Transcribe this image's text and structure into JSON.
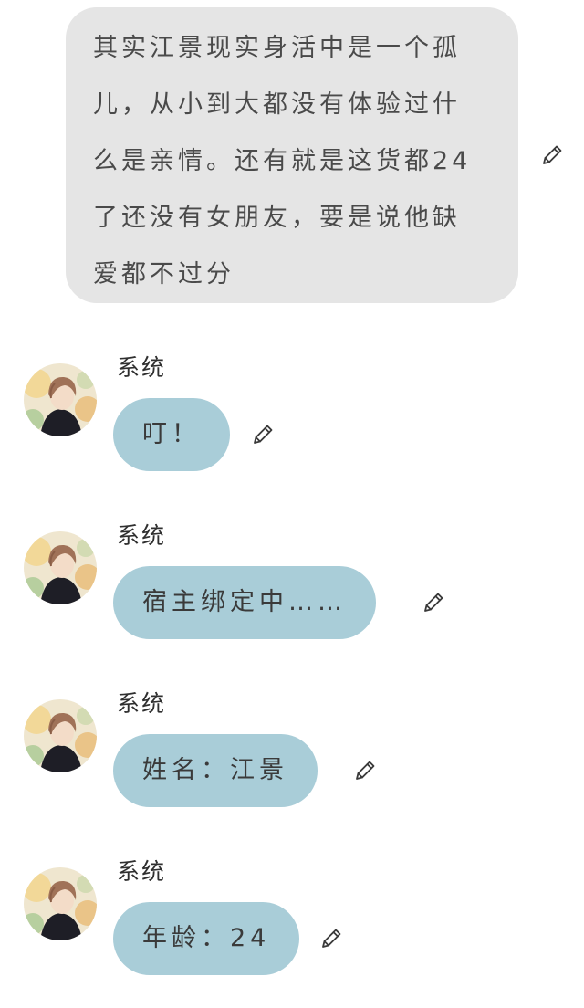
{
  "narration": {
    "lines": [
      "其实江景现实身活中是一个孤",
      "儿，从小到大都没有体验过什",
      "么是亲情。还有就是这货都24",
      "了还没有女朋友，要是说他缺",
      "爱都不过分"
    ],
    "edit_icon": "pencil-icon"
  },
  "messages": [
    {
      "sender": "系统",
      "text": "叮！",
      "avatar_icon": "anime-avatar",
      "edit_icon": "pencil-icon"
    },
    {
      "sender": "系统",
      "text": "宿主绑定中……",
      "avatar_icon": "anime-avatar",
      "edit_icon": "pencil-icon"
    },
    {
      "sender": "系统",
      "text": "姓名：江景",
      "avatar_icon": "anime-avatar",
      "edit_icon": "pencil-icon"
    },
    {
      "sender": "系统",
      "text": "年龄：24",
      "avatar_icon": "anime-avatar",
      "edit_icon": "pencil-icon"
    }
  ],
  "colors": {
    "narration_bubble": "#e5e5e5",
    "chat_bubble": "#a9cdd8",
    "background": "#ffffff"
  }
}
